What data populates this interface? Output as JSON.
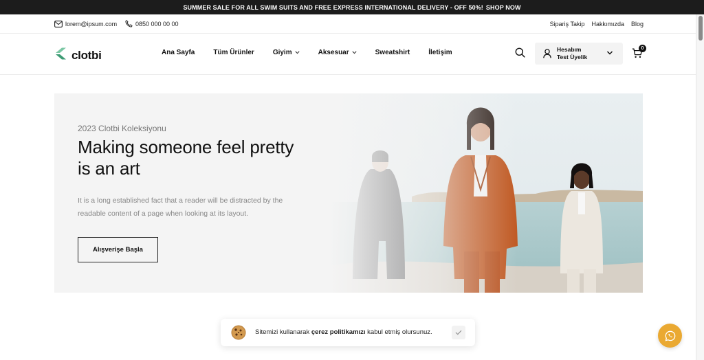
{
  "announcement": {
    "text": "SUMMER SALE FOR ALL SWIM SUITS AND FREE EXPRESS INTERNATIONAL DELIVERY - OFF 50%!",
    "link": "SHOP NOW"
  },
  "topbar": {
    "email": "lorem@ipsum.com",
    "phone": "0850 000 00 00",
    "links": [
      "Sipariş Takip",
      "Hakkımızda",
      "Blog"
    ]
  },
  "header": {
    "logo": "clotbi",
    "nav": [
      {
        "label": "Ana Sayfa",
        "dropdown": false
      },
      {
        "label": "Tüm Ürünler",
        "dropdown": false
      },
      {
        "label": "Giyim",
        "dropdown": true
      },
      {
        "label": "Aksesuar",
        "dropdown": true
      },
      {
        "label": "Sweatshirt",
        "dropdown": false
      },
      {
        "label": "İletişim",
        "dropdown": false
      }
    ],
    "account": {
      "line1": "Hesabım",
      "line2": "Test Üyelik"
    },
    "cart_count": "0"
  },
  "hero": {
    "subtitle": "2023 Clotbi Koleksiyonu",
    "title": "Making someone feel pretty is an art",
    "text": "It is a long established fact that a reader will be distracted by the readable content of a page when looking at its layout.",
    "button": "Alışverişe Başla"
  },
  "cookie": {
    "prefix": "Sitemizi kullanarak",
    "link": "çerez politikamızı",
    "suffix": "kabul etmiş olursunuz."
  },
  "colors": {
    "logo_green": "#7bc7a4",
    "whatsapp_button": "#eaa932",
    "announcement_bg": "#1c1c1c",
    "hero_bg": "#f4f4f4"
  },
  "icons": [
    "mail-icon",
    "phone-icon",
    "search-icon",
    "user-icon",
    "chevron-down-icon",
    "cart-icon",
    "cookie-icon",
    "check-icon",
    "whatsapp-icon"
  ]
}
